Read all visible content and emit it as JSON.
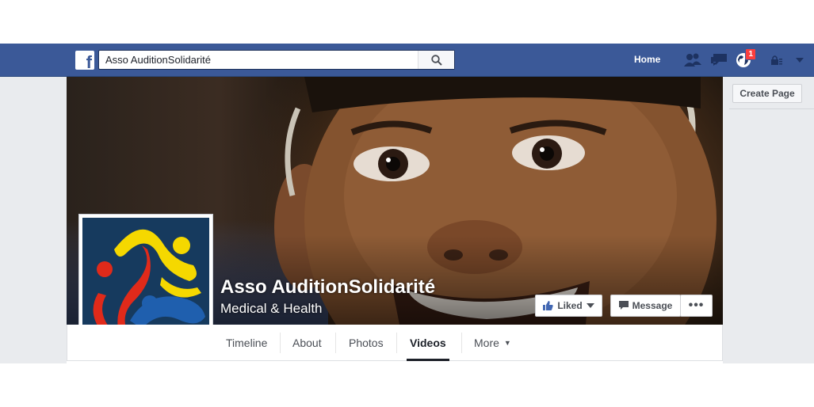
{
  "topbar": {
    "logo_letter": "f",
    "search": {
      "value": "Asso AuditionSolidarité",
      "placeholder": ""
    },
    "home_label": "Home",
    "notification_count": "1"
  },
  "right_column": {
    "create_page_label": "Create Page"
  },
  "page": {
    "name": "Asso AuditionSolidarité",
    "category": "Medical & Health",
    "actions": {
      "liked_label": "Liked",
      "message_label": "Message",
      "more_label": "•••"
    }
  },
  "tabs": [
    {
      "label": "Timeline"
    },
    {
      "label": "About"
    },
    {
      "label": "Photos"
    },
    {
      "label": "Videos",
      "active": true
    },
    {
      "label": "More"
    }
  ],
  "colors": {
    "brand": "#3b5998",
    "badge": "#fa3e3e",
    "logo_yellow": "#f5d800",
    "logo_red": "#e02a1a",
    "logo_blue": "#1f5fae"
  },
  "icons": [
    "facebook-logo-icon",
    "search-icon",
    "friend-requests-icon",
    "messages-icon",
    "notifications-globe-icon",
    "privacy-lock-icon",
    "account-dropdown-icon",
    "thumbs-up-icon",
    "caret-down-icon",
    "message-icon"
  ]
}
